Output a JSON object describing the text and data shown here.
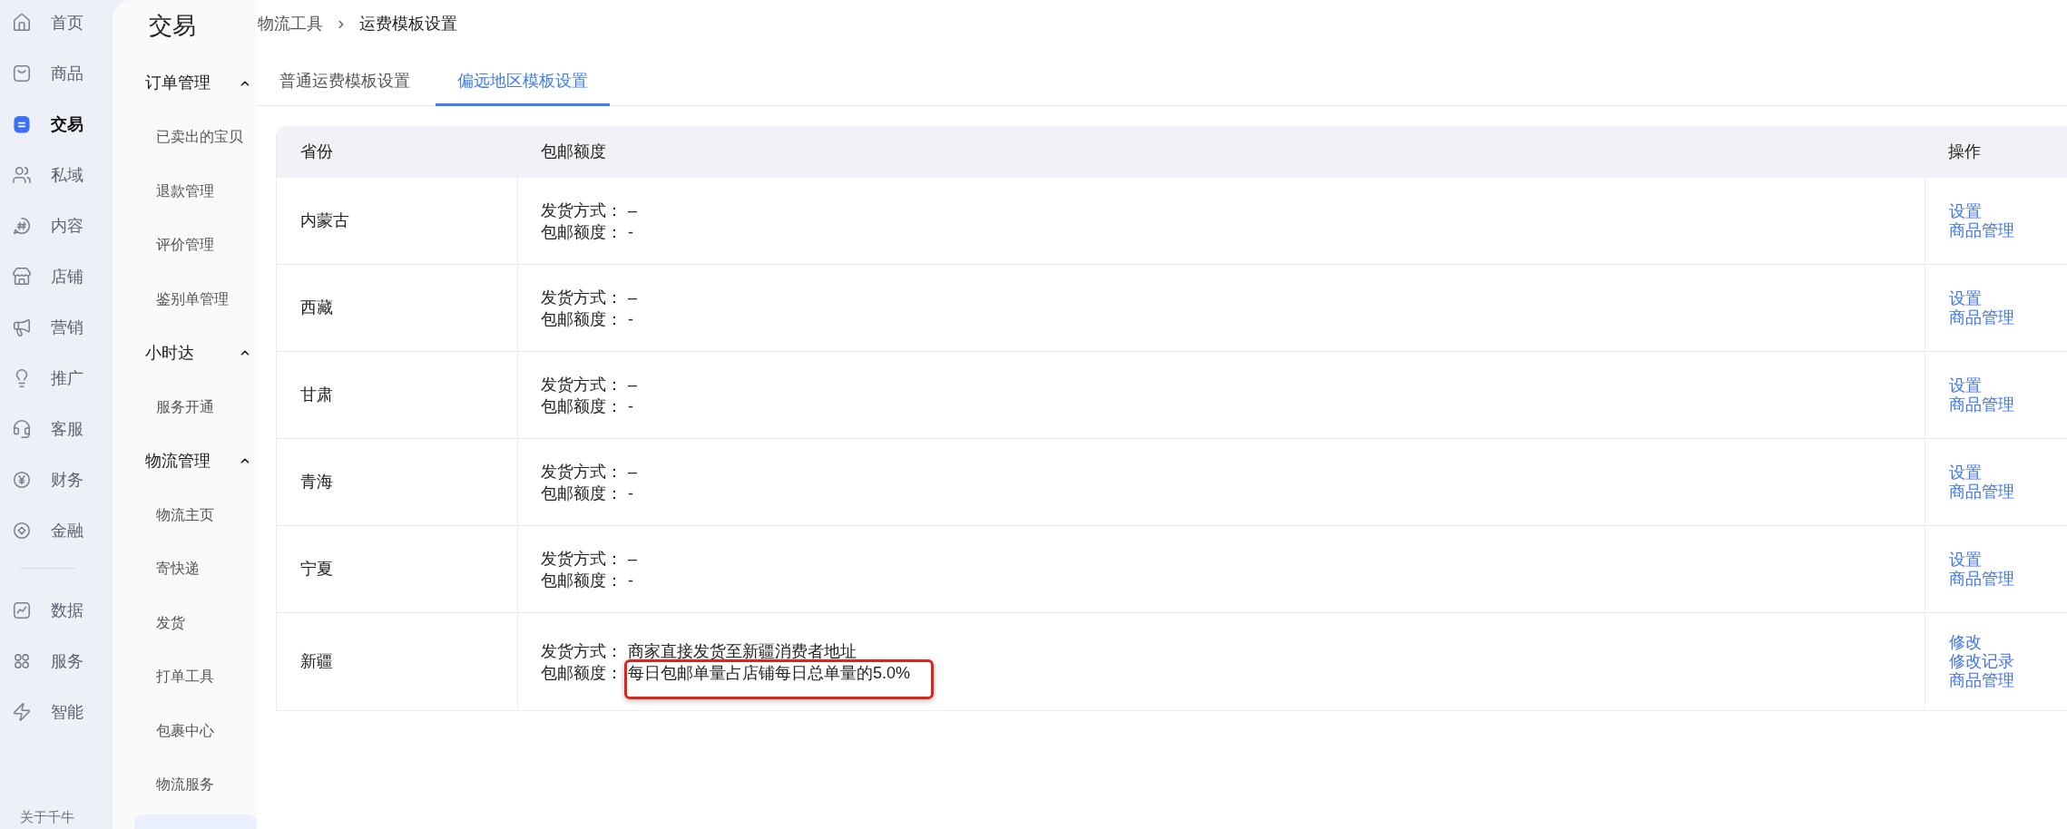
{
  "sidebar": {
    "groups": [
      {
        "items": [
          {
            "label": "首页",
            "selected": false
          },
          {
            "label": "商品",
            "selected": false
          },
          {
            "label": "交易",
            "selected": true
          },
          {
            "label": "私域",
            "selected": false
          },
          {
            "label": "内容",
            "selected": false
          },
          {
            "label": "店铺",
            "selected": false
          },
          {
            "label": "营销",
            "selected": false
          },
          {
            "label": "推广",
            "selected": false
          },
          {
            "label": "客服",
            "selected": false
          },
          {
            "label": "财务",
            "selected": false
          },
          {
            "label": "金融",
            "selected": false
          }
        ]
      },
      {
        "items": [
          {
            "label": "数据",
            "selected": false
          },
          {
            "label": "服务",
            "selected": false
          },
          {
            "label": "智能",
            "selected": false
          }
        ]
      }
    ],
    "footer": "关于千牛"
  },
  "subnav": {
    "title": "交易",
    "sections": [
      {
        "label": "订单管理",
        "expanded": true,
        "items": [
          "已卖出的宝贝",
          "退款管理",
          "评价管理",
          "鉴别单管理"
        ]
      },
      {
        "label": "小时达",
        "expanded": true,
        "items": [
          "服务开通"
        ]
      },
      {
        "label": "物流管理",
        "expanded": true,
        "items": [
          "物流主页",
          "寄快递",
          "发货",
          "打单工具",
          "包裹中心",
          "物流服务"
        ]
      }
    ],
    "selected_item_below": true
  },
  "breadcrumb": [
    "物流工具",
    "运费模板设置"
  ],
  "tabs": [
    {
      "label": "普通运费模板设置",
      "selected": false
    },
    {
      "label": "偏远地区模板设置",
      "selected": true
    }
  ],
  "table": {
    "columns": [
      "省份",
      "包邮额度",
      "操作"
    ],
    "rows": [
      {
        "province": "内蒙古",
        "shipping_method": {
          "label": "发货方式：",
          "value": "–"
        },
        "free_shipping_quota": {
          "label": "包邮额度：",
          "value": "-",
          "highlighted": false
        },
        "actions": [
          "设置",
          "商品管理"
        ]
      },
      {
        "province": "西藏",
        "shipping_method": {
          "label": "发货方式：",
          "value": "–"
        },
        "free_shipping_quota": {
          "label": "包邮额度：",
          "value": "-",
          "highlighted": false
        },
        "actions": [
          "设置",
          "商品管理"
        ]
      },
      {
        "province": "甘肃",
        "shipping_method": {
          "label": "发货方式：",
          "value": "–"
        },
        "free_shipping_quota": {
          "label": "包邮额度：",
          "value": "-",
          "highlighted": false
        },
        "actions": [
          "设置",
          "商品管理"
        ]
      },
      {
        "province": "青海",
        "shipping_method": {
          "label": "发货方式：",
          "value": "–"
        },
        "free_shipping_quota": {
          "label": "包邮额度：",
          "value": "-",
          "highlighted": false
        },
        "actions": [
          "设置",
          "商品管理"
        ]
      },
      {
        "province": "宁夏",
        "shipping_method": {
          "label": "发货方式：",
          "value": "–"
        },
        "free_shipping_quota": {
          "label": "包邮额度：",
          "value": "-",
          "highlighted": false
        },
        "actions": [
          "设置",
          "商品管理"
        ]
      },
      {
        "province": "新疆",
        "shipping_method": {
          "label": "发货方式：",
          "value": "商家直接发货至新疆消费者地址"
        },
        "free_shipping_quota": {
          "label": "包邮额度：",
          "value": "每日包邮单量占店铺每日总单量的5.0%",
          "highlighted": true
        },
        "actions": [
          "修改",
          "修改记录",
          "商品管理"
        ]
      }
    ]
  }
}
